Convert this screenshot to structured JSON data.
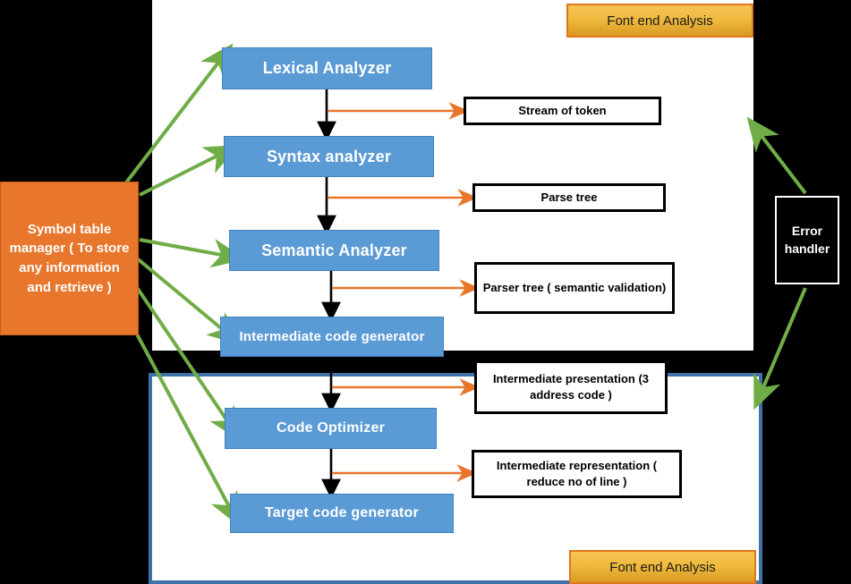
{
  "diagram": {
    "title": "Compiler phases diagram",
    "colors": {
      "process_fill": "#5B9BD5",
      "symbol_table_fill": "#E8762C",
      "banner_fill": "#F0BA3F",
      "flow_arrow": "#000000",
      "output_arrow": "#E8762C",
      "reference_arrow": "#70AD47",
      "panel_border": "#3E72A8"
    }
  },
  "banners": {
    "top": "Font end Analysis",
    "bottom": "Font end Analysis"
  },
  "processes": [
    {
      "label": "Lexical Analyzer"
    },
    {
      "label": "Syntax analyzer"
    },
    {
      "label": "Semantic Analyzer"
    },
    {
      "label": "Intermediate code generator"
    },
    {
      "label": "Code Optimizer"
    },
    {
      "label": "Target code generator"
    }
  ],
  "outputs": [
    {
      "label": "Stream of token"
    },
    {
      "label": "Parse tree"
    },
    {
      "label": "Parser tree ( semantic validation)"
    },
    {
      "label": "Intermediate presentation (3 address code )"
    },
    {
      "label": "Intermediate representation ( reduce no of line )"
    }
  ],
  "symbol_table": {
    "label": "Symbol table manager ( To store any information and retrieve )"
  },
  "error_handler": {
    "label": "Error handler"
  }
}
